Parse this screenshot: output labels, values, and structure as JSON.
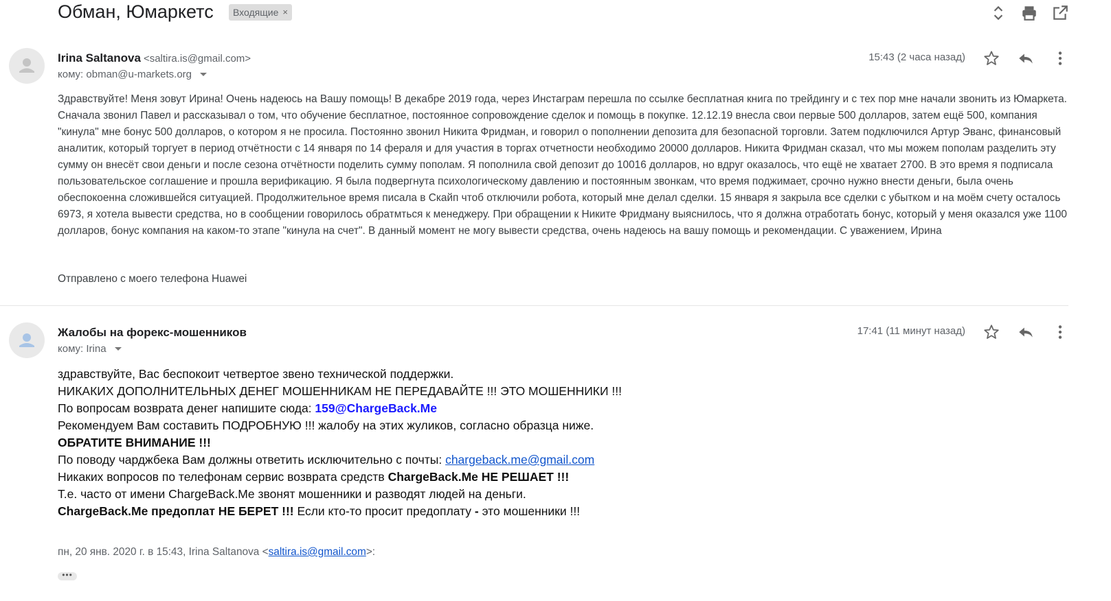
{
  "thread": {
    "subject": "Обман, Юмаркетс",
    "label": "Входящие",
    "label_remove": "×"
  },
  "toolbar_icons": [
    "expand-collapse-icon",
    "print-icon",
    "open-in-new-window-icon"
  ],
  "messages": [
    {
      "sender_name": "Irina Saltanova",
      "sender_email": "<saltira.is@gmail.com>",
      "to": "кому: obman@u-markets.org",
      "time": "15:43 (2 часа назад)",
      "body": "Здравствуйте! Меня зовут Ирина! Очень надеюсь на Вашу помощь! В декабре 2019 года, через Инстаграм перешла по ссылке бесплатная книга по трейдингу и с тех пор мне начали звонить из Юмаркета. Сначала звонил Павел и рассказывал о том, что обучение бесплатное, постоянное сопровождение сделок и помощь в покупке. 12.12.19 внесла свои первые 500 долларов, затем ещё 500, компания \"кинула\" мне бонус 500 долларов, о котором я не просила. Постоянно звонил Никита Фридман, и говорил о пополнении депозита для безопасной торговли. Затем подключился Артур Эванс, финансовый аналитик, который торгует в период отчётности с 14 января по 14 фераля и для участия в торгах отчетности необходимо 20000 долларов. Никита Фридман сказал, что мы можем пополам разделить эту сумму он внесёт свои деньги и после сезона отчётности поделить сумму пополам. Я пополнила свой депозит до 10016 долларов, но вдруг оказалось, что ещё не хватает 2700. В это время я подписала пользовательское соглашение и прошла верификацию. Я была подвергнута психологическому давлению и постоянным звонкам, что время поджимает, срочно нужно внести деньги, была очень обеспокоенна сложившейся ситуацией. Продолжительное время писала в Скайп чтоб отключили робота, который мне делал сделки. 15 января я закрыла все сделки с убытком и на моём счету осталось 6973, я хотела вывести средства, но в сообщении говорилось обратмться к менеджеру. При обращении к Никите Фридману выяснилось, что я должна отработать бонус, который у меня оказался уже 1100 долларов, бонус компания на каком-то этапе \"кинула на счет\". В данный момент не могу вывести средства, очень надеюсь на вашу помощь и рекомендации. С уважением, Ирина",
      "signature": "Отправлено с моего телефона Huawei"
    },
    {
      "sender_name": "Жалобы на форекс-мошенников",
      "to": "кому: Irina",
      "time": "17:41 (11 минут назад)",
      "lines": {
        "l1": "здравствуйте, Вас беспокоит четвертое звено технической поддержки.",
        "l2": "НИКАКИХ ДОПОЛНИТЕЛЬНЫХ ДЕНЕГ МОШЕННИКАМ НЕ ПЕРЕДАВАЙТЕ !!! ЭТО МОШЕННИКИ !!!",
        "l3_text": "По вопросам возврата денег напишите сюда: ",
        "l3_link": "159@ChargeBack.Me",
        "l4": "Рекомендуем Вам составить ПОДРОБНУЮ !!! жалобу на этих жуликов, согласно образца ниже.",
        "l5": "ОБРАТИТЕ ВНИМАНИЕ !!!",
        "l6_text": "По поводу чарджбека Вам должны ответить исключительно с почты: ",
        "l6_link": "chargeback.me@gmail.com",
        "l7_text": "Никаких вопросов по телефонам сервис возврата средств ",
        "l7_bold": "ChargeBack.Me НЕ РЕШАЕТ !!!",
        "l8": "Т.е. часто от имени ChargeBack.Me звонят мошенники и разводят людей на деньги.",
        "l9_bold": "ChargeBack.Me предоплат НЕ БЕРЕТ !!!",
        "l9_text": " Если кто-то просит предоплату ",
        "l9_dash": "-",
        "l9_end": " это мошенники !!!"
      },
      "quote": {
        "prefix": "пн, 20 янв. 2020 г. в 15:43, Irina Saltanova <",
        "email": "saltira.is@gmail.com",
        "suffix": ">:"
      },
      "more": "•••"
    }
  ]
}
